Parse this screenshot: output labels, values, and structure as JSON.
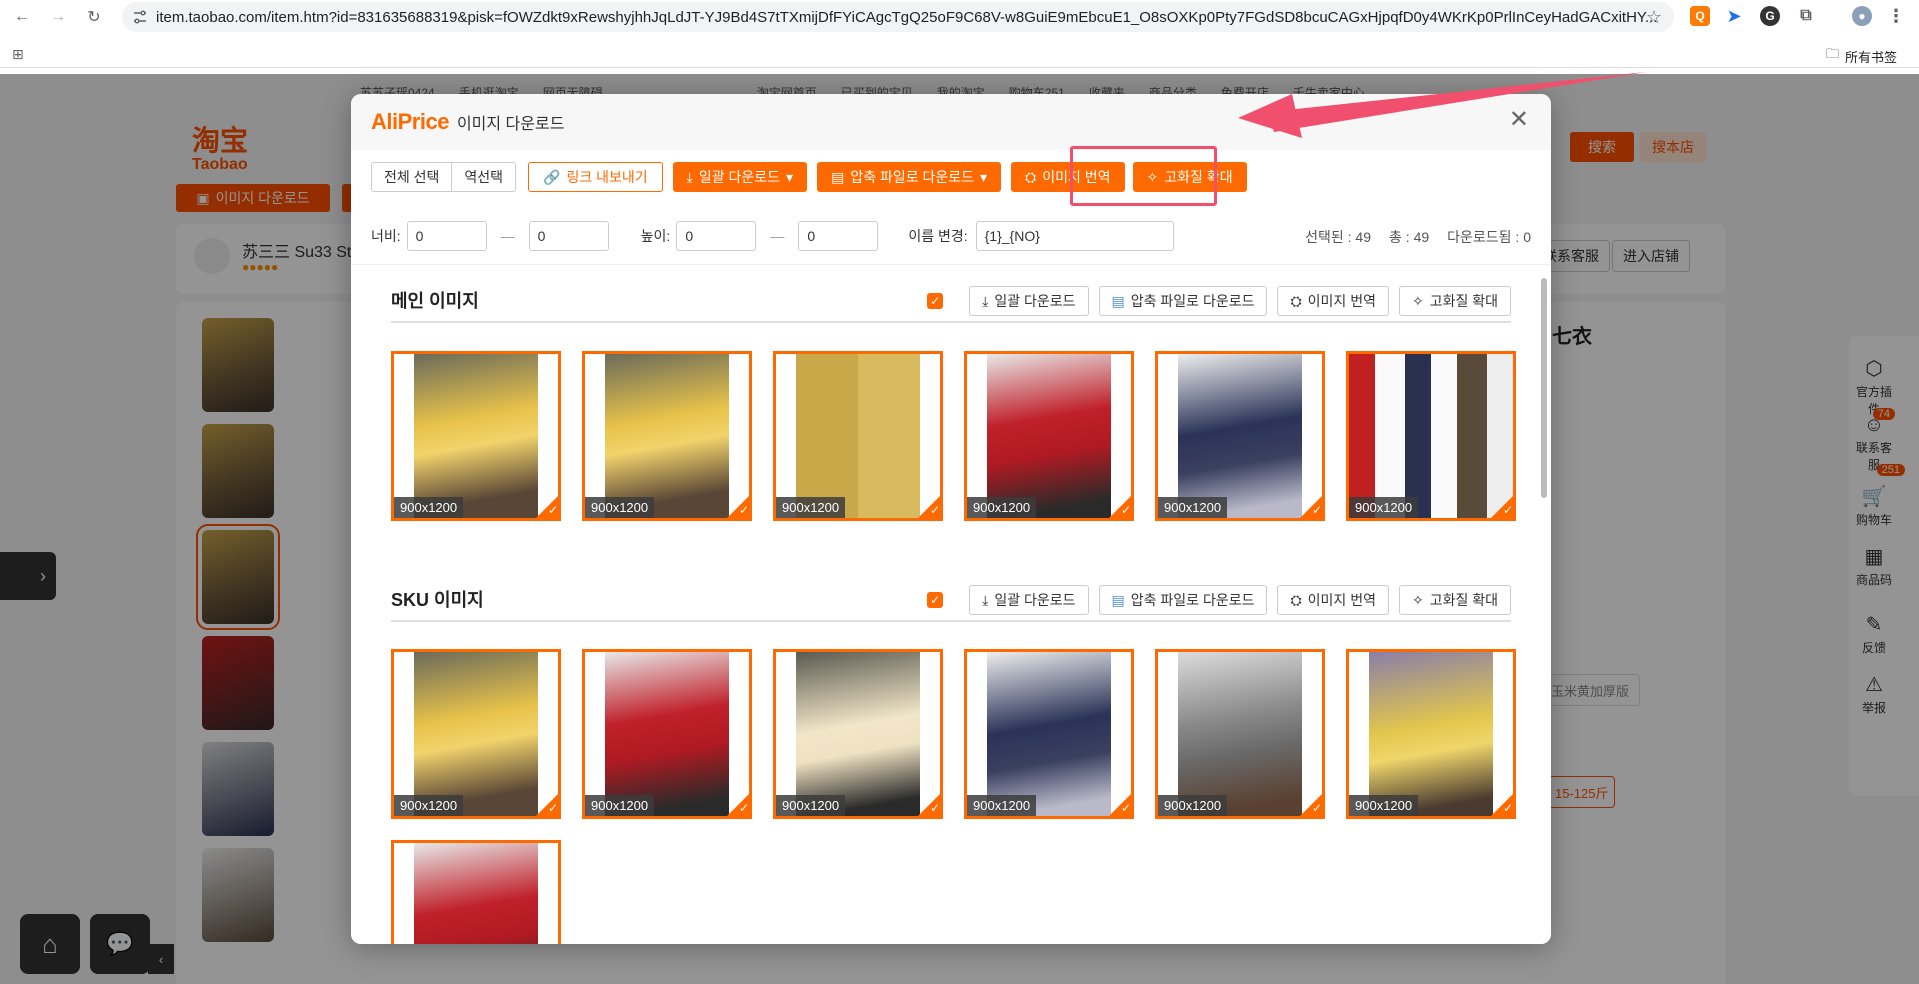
{
  "browser": {
    "url": "item.taobao.com/item.htm?id=831635688319&pisk=fOWZdkt9xRewshyjhhJqLdJT-YJ9Bd4S7tTXmijDfFYiCAgcTgQ25oF9C68V-w8GuiE9mEbcuE1_O8sOXKp0Pty7FGdSD8bcuCAGxHjpqfD0y4WKrKp0PrlInCeyHadGACxitHY...",
    "bookmarks_label": "所有书签"
  },
  "taobao": {
    "logo_cn": "淘宝",
    "logo_en": "Taobao",
    "top_links": [
      "苏苏子瑶0424",
      "手机逛淘宝",
      "网页无障碍",
      "淘宝网首页",
      "已买到的宝贝",
      "我的淘宝",
      "购物车251",
      "收藏夹",
      "商品分类",
      "免费开店",
      "千牛卖家中心"
    ],
    "download_btn": "이미지 다운로드",
    "shop_name": "苏三三 Su33 St",
    "search_btn": "搜索",
    "search_shop_btn": "搜本店",
    "contact_btn": "联系客服",
    "enter_shop_btn": "进入店铺",
    "title_fragment": "七衣",
    "sku_option": "玉米黄加厚版",
    "size_option": "15-125斤",
    "side_tools": [
      {
        "label": "官方插件",
        "icon": "plugin-icon"
      },
      {
        "label": "联系客服",
        "icon": "service-icon",
        "badge": "74"
      },
      {
        "label": "购物车",
        "icon": "cart-icon",
        "badge": "251"
      },
      {
        "label": "商品码",
        "icon": "qrcode-icon"
      },
      {
        "label": "反馈",
        "icon": "edit-icon"
      },
      {
        "label": "举报",
        "icon": "warning-icon"
      }
    ]
  },
  "modal": {
    "brand": "AliPrice",
    "title": "이미지 다운로드",
    "toolbar": {
      "select_all": "전체 선택",
      "invert": "역선택",
      "export_links": "링크 내보내기",
      "bulk_download": "일괄 다운로드",
      "zip_download": "압축 파일로 다운로드",
      "translate": "이미지 번역",
      "upscale": "고화질 확대"
    },
    "filter": {
      "width_label": "너비:",
      "width_min": "0",
      "width_max": "0",
      "height_label": "높이:",
      "height_min": "0",
      "height_max": "0",
      "rename_label": "이름 변경:",
      "rename_value": "{1}_{NO}",
      "selected": "선택된 : 49",
      "total": "총 : 49",
      "downloaded": "다운로드됨 : 0"
    },
    "sections": [
      {
        "title": "메인 이미지",
        "bulk_download": "일괄 다운로드",
        "zip_download": "압축 파일로 다운로드",
        "translate": "이미지 번역",
        "upscale": "고화질 확대",
        "images": [
          {
            "size": "900x1200",
            "tone": "yellow"
          },
          {
            "size": "900x1200",
            "tone": "yellow"
          },
          {
            "size": "900x1200",
            "tone": "collage"
          },
          {
            "size": "900x1200",
            "tone": "red"
          },
          {
            "size": "900x1200",
            "tone": "navy"
          },
          {
            "size": "900x1200",
            "tone": "lineup"
          }
        ]
      },
      {
        "title": "SKU 이미지",
        "bulk_download": "일괄 다운로드",
        "zip_download": "압축 파일로 다운로드",
        "translate": "이미지 번역",
        "upscale": "고화질 확대",
        "images": [
          {
            "size": "900x1200",
            "tone": "yellow"
          },
          {
            "size": "900x1200",
            "tone": "red"
          },
          {
            "size": "900x1200",
            "tone": "cream"
          },
          {
            "size": "900x1200",
            "tone": "navy"
          },
          {
            "size": "900x1200",
            "tone": "grey"
          },
          {
            "size": "900x1200",
            "tone": "yellow2"
          },
          {
            "size": "",
            "tone": "red"
          }
        ]
      }
    ]
  },
  "colors": {
    "accent": "#ff6a00",
    "taobao": "#ff5000",
    "highlight": "#f0506e"
  }
}
